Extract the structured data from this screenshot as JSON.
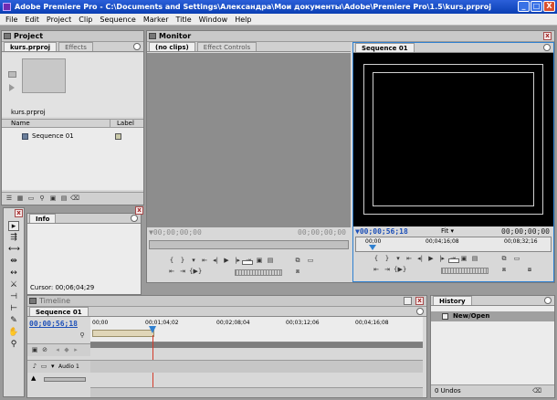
{
  "window": {
    "title": "Adobe Premiere Pro - C:\\Documents and Settings\\Александра\\Мои документы\\Adobe\\Premiere Pro\\1.5\\kurs.prproj",
    "minimize": "_",
    "maximize": "□",
    "close": "X"
  },
  "menu": [
    "File",
    "Edit",
    "Project",
    "Clip",
    "Sequence",
    "Marker",
    "Title",
    "Window",
    "Help"
  ],
  "project": {
    "panel_title": "Project",
    "tab_active": "kurs.prproj",
    "tab_inactive": "Effects",
    "thumb_caption": "kurs.prproj",
    "col_name": "Name",
    "col_label": "Label",
    "item": "Sequence 01",
    "label_color": "#c9c9a8"
  },
  "monitor": {
    "panel_title": "Monitor",
    "source_tab": "(no clips)",
    "effect_tab": "Effect Controls",
    "program_tab": "Sequence 01",
    "source_tc_in": "00;00;00;00",
    "source_tc_out": "00;00;00;00",
    "program_tc_in": "00;00;56;18",
    "program_zoom": "Fit",
    "program_tc_out": "00;00;00;00",
    "ruler": [
      "00;00",
      "00;04;16;08",
      "00;08;32;16"
    ]
  },
  "info": {
    "tab": "Info",
    "cursor": "Cursor: 00;06;04;29"
  },
  "timeline": {
    "panel_title": "Timeline",
    "tab": "Sequence 01",
    "tc": "00;00;56;18",
    "ruler": [
      "00;00",
      "00;01;04;02",
      "00;02;08;04",
      "00;03;12;06",
      "00;04;16;08"
    ],
    "track": "Audio 1"
  },
  "history": {
    "tab": "History",
    "item": "New/Open",
    "undos": "0 Undos"
  },
  "colors": {
    "titlebar": "#0a3fb3",
    "accent_blue": "#1c4fb8",
    "playhead": "#d23a2a",
    "program_border": "#2f80d0"
  }
}
